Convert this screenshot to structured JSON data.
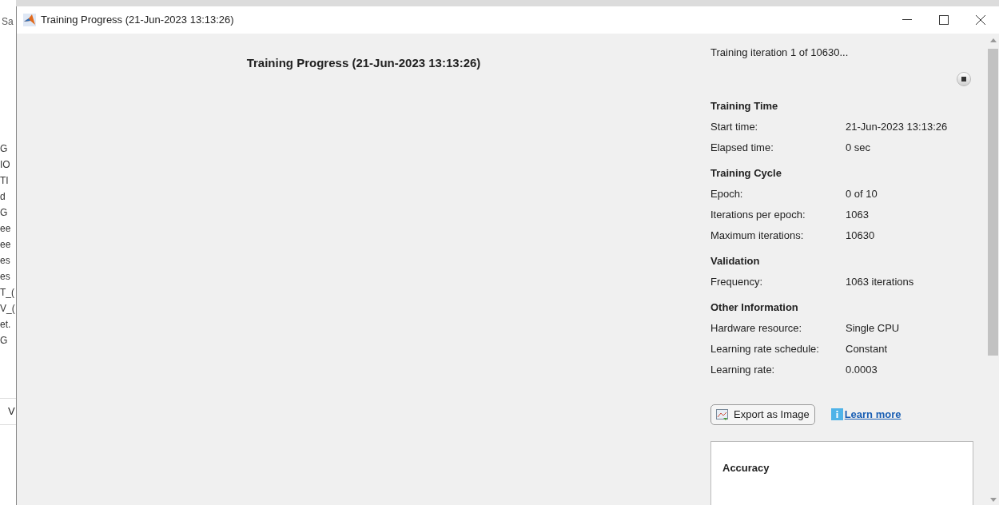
{
  "background_window": {
    "fragments": [
      "Sa",
      "G",
      "IO",
      "TI",
      "d",
      "G",
      "ee",
      "ee",
      "es",
      "es",
      "T_(",
      "V_(",
      "et.",
      "G"
    ],
    "field_fragment": "V"
  },
  "window": {
    "title": "Training Progress (21-Jun-2023 13:13:26)"
  },
  "plot_title": "Training Progress (21-Jun-2023 13:13:26)",
  "status": "Training iteration 1 of 10630...",
  "sections": [
    {
      "heading": "Training Time",
      "rows": [
        {
          "label": "Start time:",
          "value": "21-Jun-2023 13:13:26"
        },
        {
          "label": "Elapsed time:",
          "value": "0 sec"
        }
      ]
    },
    {
      "heading": "Training Cycle",
      "rows": [
        {
          "label": "Epoch:",
          "value": "0 of 10"
        },
        {
          "label": "Iterations per epoch:",
          "value": "1063"
        },
        {
          "label": "Maximum iterations:",
          "value": "10630"
        }
      ]
    },
    {
      "heading": "Validation",
      "rows": [
        {
          "label": "Frequency:",
          "value": "1063 iterations"
        }
      ]
    },
    {
      "heading": "Other Information",
      "rows": [
        {
          "label": "Hardware resource:",
          "value": "Single CPU"
        },
        {
          "label": "Learning rate schedule:",
          "value": "Constant"
        },
        {
          "label": "Learning rate:",
          "value": "0.0003"
        }
      ]
    }
  ],
  "export_button": "Export as Image",
  "learn_more": "Learn more",
  "accuracy_panel": {
    "title": "Accuracy"
  }
}
